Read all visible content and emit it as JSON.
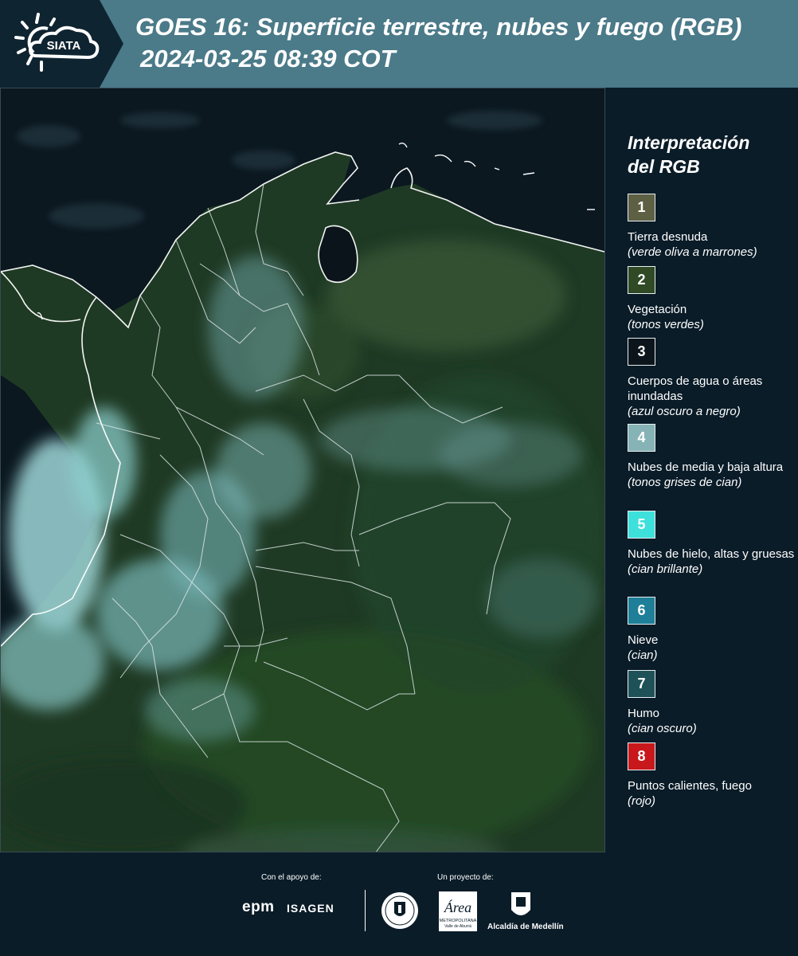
{
  "header": {
    "brand": "SIATA",
    "title": "GOES 16: Superficie terrestre, nubes y fuego (RGB)",
    "subtitle": "2024-03-25 08:39 COT"
  },
  "legend": {
    "title_line1": "Interpretación",
    "title_line2": "del RGB",
    "items": [
      {
        "num": "1",
        "label": "Tierra desnuda",
        "note": "(verde oliva a marrones)",
        "color": "#5e6044"
      },
      {
        "num": "2",
        "label": "Vegetación",
        "note": "(tonos verdes)",
        "color": "#2f4a24"
      },
      {
        "num": "3",
        "label": "Cuerpos de agua o áreas inundadas",
        "note": "(azul oscuro a negro)",
        "color": "#0c151b"
      },
      {
        "num": "4",
        "label": "Nubes de media y baja altura",
        "note": "(tonos grises de cian)",
        "color": "#86b3b6"
      },
      {
        "num": "5",
        "label": "Nubes de hielo, altas y gruesas",
        "note": "(cian brillante)",
        "color": "#3ee0dc"
      },
      {
        "num": "6",
        "label": "Nieve",
        "note": "(cian)",
        "color": "#1f7f98"
      },
      {
        "num": "7",
        "label": "Humo",
        "note": "(cian oscuro)",
        "color": "#1e5258"
      },
      {
        "num": "8",
        "label": "Puntos calientes, fuego",
        "note": "(rojo)",
        "color": "#c8181c"
      }
    ]
  },
  "footer": {
    "support_label": "Con el apoyo de:",
    "project_label": "Un proyecto de:",
    "epm": "epm",
    "isagen": "ISAGEN",
    "area_name": "Área",
    "area_sub": "METROPOLITANA",
    "area_sub2": "Valle de Aburrá",
    "alcaldia": "Alcaldía de Medellín"
  },
  "colors": {
    "header_bg": "#4b7a89",
    "logo_panel": "#0f2431",
    "page_bg": "#0a1c28"
  }
}
